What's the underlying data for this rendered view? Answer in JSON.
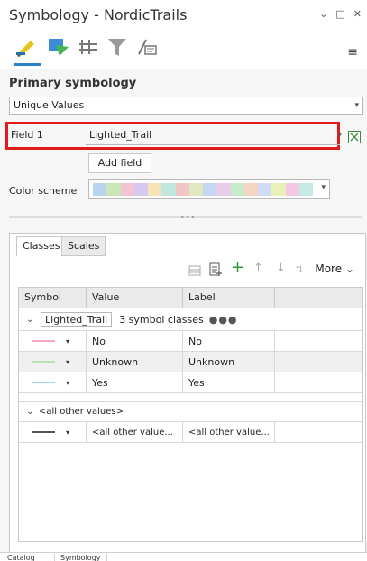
{
  "window": {
    "title": "Symbology - NordicTrails",
    "controls": [
      "⌄",
      "□",
      "✕"
    ]
  },
  "toolbar": {
    "icons": [
      "primary-symbology-icon",
      "vary-symbology-icon",
      "symbol-layer-drawing-icon",
      "mask-icon",
      "feature-label-icon"
    ],
    "menu_icon": "≡"
  },
  "primary": {
    "section_title": "Primary symbology",
    "renderer_value": "Unique Values",
    "field1_label": "Field 1",
    "field1_value": "Lighted_Trail",
    "add_field_label": "Add field",
    "color_scheme_label": "Color scheme",
    "color_scheme_colors": [
      "#b9d4f0",
      "#cde6b8",
      "#f2c4d4",
      "#d6c8ef",
      "#f6e3b8",
      "#c1e6de",
      "#f3c6c6",
      "#dfe8c0",
      "#c6d7f4",
      "#e8cdea",
      "#c8ebc9",
      "#f3d5c1",
      "#d0dcf5",
      "#e9f0b8",
      "#f2c8e4",
      "#c5e9e5"
    ]
  },
  "tabs": {
    "classes_label": "Classes",
    "scales_label": "Scales"
  },
  "class_toolbar": {
    "more_label": "More",
    "more_chevron": "⌄"
  },
  "grid": {
    "headers": [
      "Symbol",
      "Value",
      "Label",
      ""
    ],
    "group": {
      "name": "Lighted_Trail",
      "info": "3 symbol classes",
      "dots": "●●●"
    },
    "rows": [
      {
        "value": "No",
        "label": "No",
        "color": "#f4a9c1"
      },
      {
        "value": "Unknown",
        "label": "Unknown",
        "color": "#b8e2b5"
      },
      {
        "value": "Yes",
        "label": "Yes",
        "color": "#9fd8f2"
      }
    ],
    "other_group_label": "<all other values>",
    "other_row": {
      "value": "<all other value...",
      "label": "<all other value...",
      "color": "#555555"
    }
  },
  "bottom_tabs": [
    "Catalog",
    "Symbology"
  ]
}
